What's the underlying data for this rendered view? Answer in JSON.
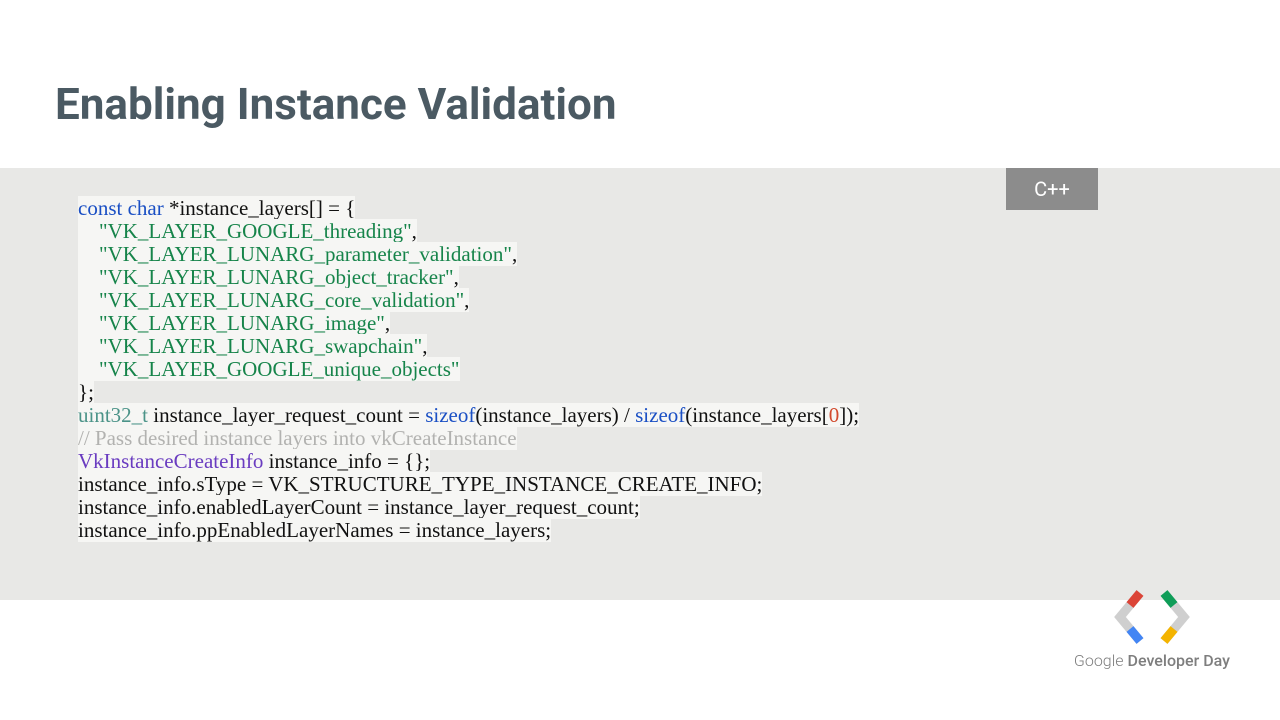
{
  "title": "Enabling Instance Validation",
  "lang_label": "C++",
  "code": {
    "kw_const": "const",
    "kw_char": "char",
    "decl_head": " *instance_layers[] = {",
    "layers": [
      "\"VK_LAYER_GOOGLE_threading\"",
      "\"VK_LAYER_LUNARG_parameter_validation\"",
      "\"VK_LAYER_LUNARG_object_tracker\"",
      "\"VK_LAYER_LUNARG_core_validation\"",
      "\"VK_LAYER_LUNARG_image\"",
      "\"VK_LAYER_LUNARG_swapchain\"",
      "\"VK_LAYER_GOOGLE_unique_objects\""
    ],
    "close_brace": "};",
    "ty_uint32": "uint32_t",
    "count_lhs": " instance_layer_request_count = ",
    "kw_sizeof1": "sizeof",
    "count_arg1": "(instance_layers)",
    "count_div": " / ",
    "kw_sizeof2": "sizeof",
    "count_arg2a": "(instance_layers[",
    "count_idx": "0",
    "count_arg2b": "]);",
    "comment": "// Pass desired instance layers into vkCreateInstance",
    "cls_info": "VkInstanceCreateInfo",
    "info_decl": " instance_info = {};",
    "line_sType": "instance_info.sType = VK_STRUCTURE_TYPE_INSTANCE_CREATE_INFO;",
    "line_count": "instance_info.enabledLayerCount = instance_layer_request_count;",
    "line_names": "instance_info.ppEnabledLayerNames = instance_layers;"
  },
  "footer": {
    "google": "Google",
    "rest": " Developer Day"
  },
  "colors": {
    "red": "#db4437",
    "blue": "#4285f4",
    "green": "#0f9d58",
    "yellow": "#f4b400",
    "grey": "#cfcfcf"
  }
}
